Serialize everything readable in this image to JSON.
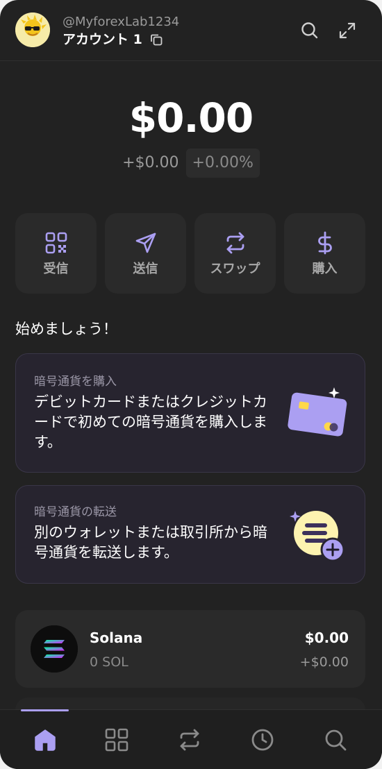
{
  "header": {
    "handle": "@MyforexLab1234",
    "account_name": "アカウント 1",
    "icons": [
      "avatar",
      "copy-icon",
      "search-icon",
      "expand-icon"
    ]
  },
  "balance": {
    "total": "$0.00",
    "change_value": "+$0.00",
    "change_percent": "+0.00%"
  },
  "actions": [
    {
      "label": "受信",
      "icon": "qr-code-icon"
    },
    {
      "label": "送信",
      "icon": "send-icon"
    },
    {
      "label": "スワップ",
      "icon": "swap-icon"
    },
    {
      "label": "購入",
      "icon": "dollar-icon"
    }
  ],
  "getting_started": {
    "title": "始めましょう！",
    "cards": [
      {
        "title": "暗号通貨を購入",
        "body": "デビットカードまたはクレジットカードで初めての暗号通貨を購入します。",
        "icon": "credit-card-illustration"
      },
      {
        "title": "暗号通貨の転送",
        "body": "別のウォレットまたは取引所から暗号通貨を転送します。",
        "icon": "transfer-coin-illustration"
      }
    ]
  },
  "tokens": [
    {
      "name": "Solana",
      "amount": "0 SOL",
      "value": "$0.00",
      "change": "+$0.00",
      "icon": "solana-logo-icon"
    }
  ],
  "bottom_nav": {
    "items": [
      "home-icon",
      "grid-icon",
      "swap-icon",
      "history-icon",
      "search-icon"
    ],
    "active": "home-icon"
  },
  "colors": {
    "background": "#222222",
    "accent": "#ab9ff2",
    "card": "#2a2a2a",
    "promo_card": "#27242f"
  }
}
